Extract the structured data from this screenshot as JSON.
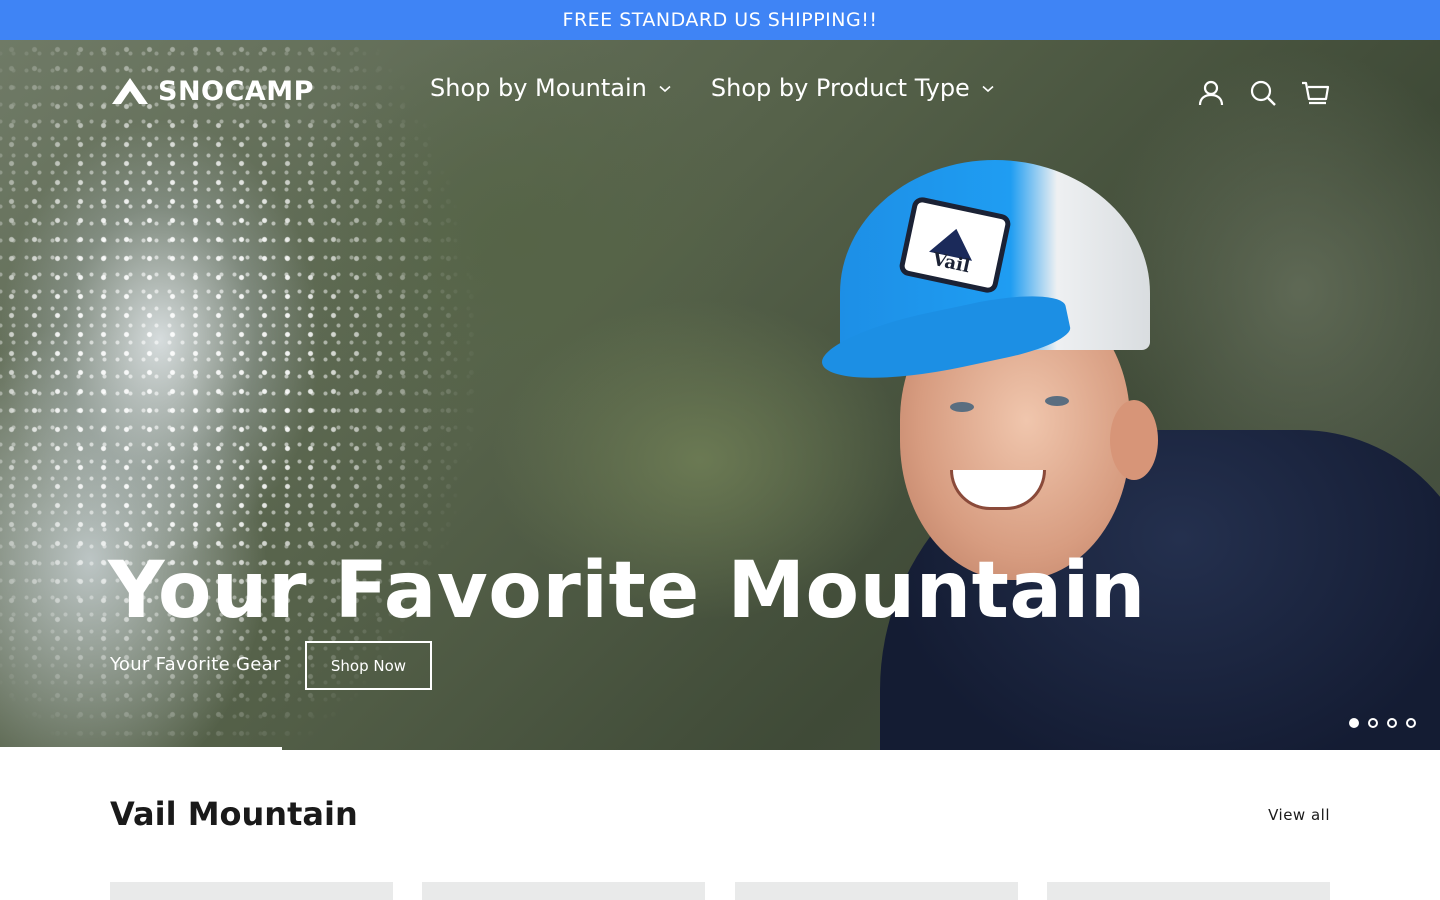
{
  "announcement": {
    "text": "FREE STANDARD US SHIPPING!!"
  },
  "brand": {
    "name": "SNOCAMP"
  },
  "nav": {
    "items": [
      {
        "label": "Shop by Mountain"
      },
      {
        "label": "Shop by Product Type"
      }
    ]
  },
  "utility": {
    "icons": [
      "account-icon",
      "search-icon",
      "cart-icon"
    ]
  },
  "hero": {
    "title": "Your Favorite Mountain",
    "subtitle": "Your Favorite Gear",
    "cta_label": "Shop Now",
    "cap_logo_text": "Vail",
    "slide_count": 4,
    "active_slide": 1
  },
  "section": {
    "title": "Vail Mountain",
    "view_all_label": "View all"
  },
  "colors": {
    "announcement_bg": "#3f84f5",
    "text_dark": "#1a1a1a",
    "white": "#ffffff"
  }
}
